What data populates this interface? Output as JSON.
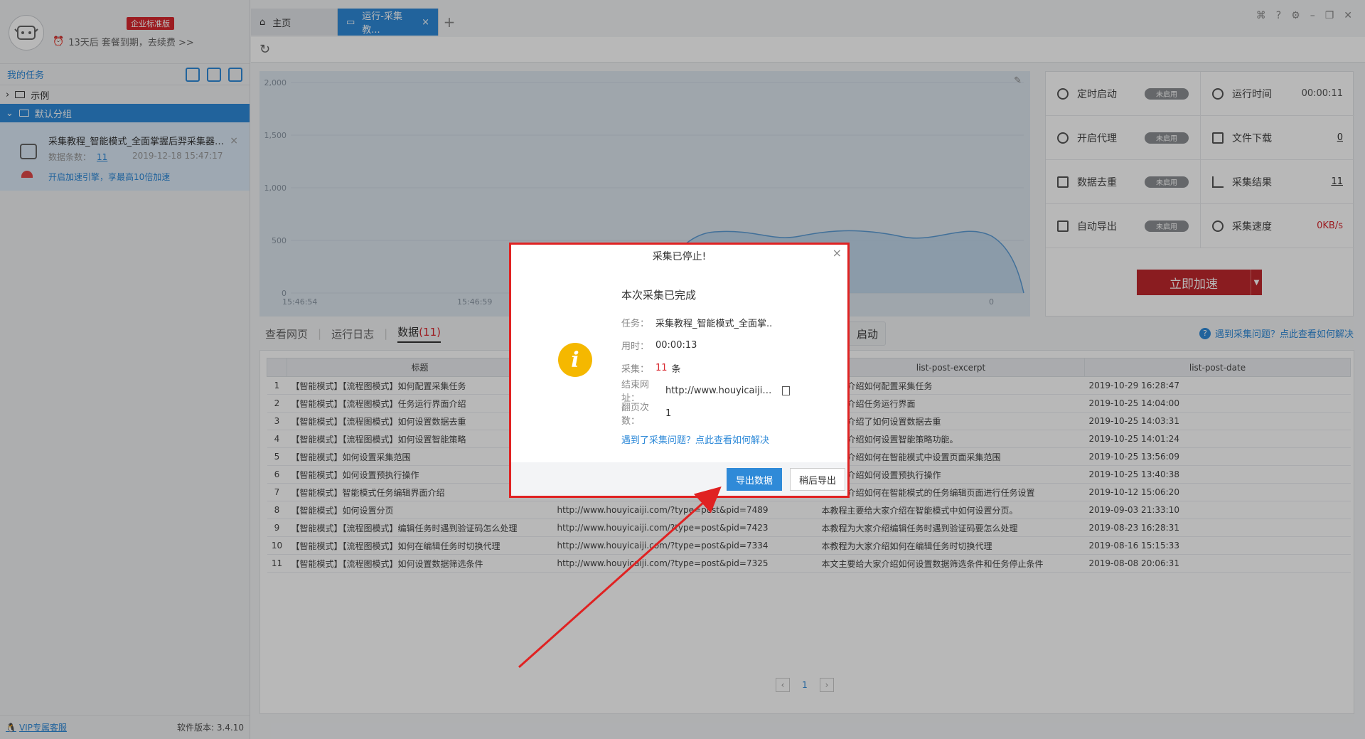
{
  "user": {
    "edition_badge": "企业标准版",
    "expire_text": "13天后 套餐到期，去续费 >>"
  },
  "sidebar": {
    "my_tasks": "我的任务",
    "groups": [
      {
        "label": "示例",
        "expanded": false
      },
      {
        "label": "默认分组",
        "expanded": true
      }
    ],
    "task": {
      "name": "采集教程_智能模式_全面掌握后羿采集器的...",
      "count_label": "数据条数：",
      "count": "11",
      "date": "2019-12-18 15:47:17",
      "accel_text": "开启加速引擎，享最高10倍加速"
    },
    "footer": {
      "vip_label": "VIP专属客服",
      "version": "软件版本: 3.4.10"
    }
  },
  "tabs": {
    "home": "主页",
    "active": "运行-采集教..."
  },
  "chart_data": {
    "type": "area",
    "y_ticks": [
      "2,000",
      "1,500",
      "1,000",
      "500",
      "0"
    ],
    "x_ticks": [
      "15:46:54",
      "15:46:59"
    ],
    "right_label": "0",
    "ylim": [
      0,
      2000
    ],
    "grid": true,
    "color": "#bcd3ea",
    "line_color": "#5b9bd5"
  },
  "stats": {
    "timer": {
      "label": "定时启动",
      "state": "未启用"
    },
    "runtime": {
      "label": "运行时间",
      "value": "00:00:11"
    },
    "proxy": {
      "label": "开启代理",
      "state": "未启用"
    },
    "download": {
      "label": "文件下载",
      "value": "0"
    },
    "dedup": {
      "label": "数据去重",
      "state": "未启用"
    },
    "result": {
      "label": "采集结果",
      "value": "11"
    },
    "autoexport": {
      "label": "自动导出",
      "state": "未启用"
    },
    "speed": {
      "label": "采集速度",
      "value": "0KB/s"
    },
    "accel_button": "立即加速"
  },
  "subtabs": {
    "view_page": "查看网页",
    "run_log": "运行日志",
    "data": "数据",
    "data_count": "(11)",
    "restart": "启动"
  },
  "help_text": "遇到采集问题？点此查看如何解决",
  "table": {
    "headers": [
      "",
      "标题",
      "",
      "list-post-excerpt",
      "list-post-date"
    ],
    "rows": [
      [
        "1",
        "【智能模式】【流程图模式】如何配置采集任务",
        "",
        "为大家介绍如何配置采集任务",
        "2019-10-29 16:28:47"
      ],
      [
        "2",
        "【智能模式】【流程图模式】任务运行界面介绍",
        "",
        "为大家介绍任务运行界面",
        "2019-10-25 14:04:00"
      ],
      [
        "3",
        "【智能模式】【流程图模式】如何设置数据去重",
        "",
        "为大家介绍了如何设置数据去重",
        "2019-10-25 14:03:31"
      ],
      [
        "4",
        "【智能模式】【流程图模式】如何设置智能策略",
        "",
        "为大家介绍如何设置智能策略功能。",
        "2019-10-25 14:01:24"
      ],
      [
        "5",
        "【智能模式】如何设置采集范围",
        "",
        "为大家介绍如何在智能模式中设置页面采集范围",
        "2019-10-25 13:56:09"
      ],
      [
        "6",
        "【智能模式】如何设置预执行操作",
        "",
        "为大家介绍如何设置预执行操作",
        "2019-10-25 13:40:38"
      ],
      [
        "7",
        "【智能模式】智能模式任务编辑界面介绍",
        "",
        "为大家介绍如何在智能模式的任务编辑页面进行任务设置",
        "2019-10-12 15:06:20"
      ],
      [
        "8",
        "【智能模式】如何设置分页",
        "http://www.houyicaiji.com/?type=post&pid=7489",
        "本教程主要给大家介绍在智能模式中如何设置分页。",
        "2019-09-03 21:33:10"
      ],
      [
        "9",
        "【智能模式】【流程图模式】编辑任务时遇到验证码怎么处理",
        "http://www.houyicaiji.com/?type=post&pid=7423",
        "本教程为大家介绍编辑任务时遇到验证码要怎么处理",
        "2019-08-23 16:28:31"
      ],
      [
        "10",
        "【智能模式】【流程图模式】如何在编辑任务时切换代理",
        "http://www.houyicaiji.com/?type=post&pid=7334",
        "本教程为大家介绍如何在编辑任务时切换代理",
        "2019-08-16 15:15:33"
      ],
      [
        "11",
        "【智能模式】【流程图模式】如何设置数据筛选条件",
        "http://www.houyicaiji.com/?type=post&pid=7325",
        "本文主要给大家介绍如何设置数据筛选条件和任务停止条件",
        "2019-08-08 20:06:31"
      ]
    ]
  },
  "pager": {
    "current": "1"
  },
  "dialog": {
    "title": "采集已停止!",
    "heading": "本次采集已完成",
    "task_label": "任务：",
    "task_value": "采集教程_智能模式_全面掌..",
    "time_label": "用时：",
    "time_value": "00:00:13",
    "count_label": "采集：",
    "count_value": "11",
    "count_unit": "条",
    "url_label": "结束网址：",
    "url_value": "http://www.houyicaiji.com/...",
    "pages_label": "翻页次数：",
    "pages_value": "1",
    "help_link": "遇到了采集问题？点此查看如何解决",
    "export_button": "导出数据",
    "later_button": "稍后导出"
  }
}
